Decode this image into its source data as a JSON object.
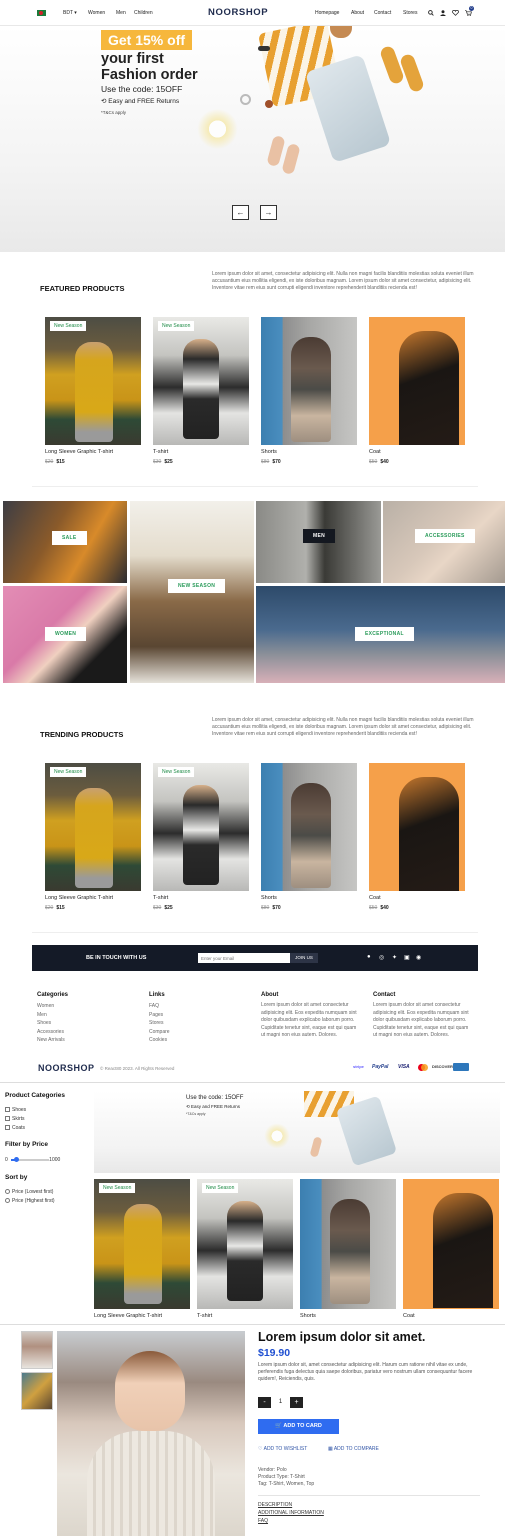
{
  "header": {
    "currency": "BDT",
    "nav_left": [
      "Women",
      "Men",
      "Children"
    ],
    "logo": "NOORSHOP",
    "nav_right": [
      "Homepage",
      "About",
      "Contact",
      "Stores"
    ],
    "cart_count": "0"
  },
  "hero": {
    "badge": "Get 15% off",
    "headline": "your first Fashion order",
    "code_text": "Use the code: 15OFF",
    "returns": "Easy and FREE Returns",
    "terms": "*T&Cs apply",
    "prev": "←",
    "next": "→"
  },
  "featured": {
    "title": "FEATURED PRODUCTS",
    "lorem": "Lorem ipsum dolor sit amet, consectetur adipisicing elit. Nulla non magni facilis blanditiis molestias soluta eveniet illum accusantium eius mollitia eligendi, ex iste doloribus magnam. Lorem ipsum dolor sit amet consectetur, adipisicing elit. Inventore vitae rem eius sunt corrupti eligendi inventore reprehenderit blanditiis recienda est!"
  },
  "products": [
    {
      "name": "Long Sleeve Graphic T-shirt",
      "old": "$20",
      "new": "$15",
      "badge": "New Season"
    },
    {
      "name": "T-shirt",
      "old": "$30",
      "new": "$25",
      "badge": "New Season"
    },
    {
      "name": "Shorts",
      "old": "$80",
      "new": "$70",
      "badge": ""
    },
    {
      "name": "Coat",
      "old": "$50",
      "new": "$40",
      "badge": ""
    }
  ],
  "collage": {
    "sale": "SALE",
    "women": "WOMEN",
    "new_season": "NEW SEASON",
    "men": "MEN",
    "accessories": "ACCESSORIES",
    "exceptional": "EXCEPTIONAL"
  },
  "trending": {
    "title": "TRENDING PRODUCTS"
  },
  "subscribe": {
    "title": "BE IN TOUCH WITH US",
    "placeholder": "Enter your Email",
    "button": "JOIN US"
  },
  "footer": {
    "categories_title": "Categories",
    "categories": [
      "Women",
      "Men",
      "Shoes",
      "Accessories",
      "New Arrivals"
    ],
    "links_title": "Links",
    "links": [
      "FAQ",
      "Pages",
      "Stores",
      "Compare",
      "Cookies"
    ],
    "about_title": "About",
    "about_text": "Lorem ipsum dolor sit amet consectetur adipisicing elit. Eos expedita numquam sint dolor quibusdam explicabo laborum porro. Cupiditate tenetur sint, eaque est qui quam ut magni non eius autem. Dolores.",
    "contact_title": "Contact",
    "contact_text": "Lorem ipsum dolor sit amet consectetur adipisicing elit. Eos expedita numquam sint dolor quibusdam explicabo laborum porro. Cupiditate tenetur sint, eaque est qui quam ut magni non eius autem. Dolores.",
    "logo": "NOORSHOP",
    "copyright": "© React80 2023. All Rights Reserved",
    "payments": [
      "stripe",
      "PayPal",
      "VISA",
      "DISCOVER"
    ]
  },
  "filters": {
    "categories_title": "Product Categories",
    "categories": [
      "Shoes",
      "Skirts",
      "Coats"
    ],
    "price_title": "Filter by Price",
    "price_min": "0",
    "price_max": "1000",
    "sort_title": "Sort by",
    "sort_options": [
      "Price (Lowest first)",
      "Price (Highest first)"
    ],
    "banner_code": "Use the code: 15OFF",
    "banner_returns": "Easy and FREE Returns",
    "banner_terms": "*T&Cs apply"
  },
  "list_products": [
    {
      "name": "Long Sleeve Graphic T-shirt",
      "badge": "New Season"
    },
    {
      "name": "T-shirt",
      "badge": "New Season"
    },
    {
      "name": "Shorts",
      "badge": ""
    },
    {
      "name": "Coat",
      "badge": ""
    }
  ],
  "product_detail": {
    "title": "Lorem ipsum dolor sit amet.",
    "price": "$19.90",
    "description": "Lorem ipsum dolor sit, amet consectetur adipisicing elit. Harum cum ratione nihil vitae ex unde, perferendis fuga delectus quia saepe doloribus, pariatur vero nostrum ullam consequuntur facere quidem!, Reiciendis, quis.",
    "qty_minus": "-",
    "qty": "1",
    "qty_plus": "+",
    "add_to_cart": "ADD TO CARD",
    "wishlist": "ADD TO WISHLIST",
    "compare": "ADD TO COMPARE",
    "vendor": "Vendor: Polo",
    "type": "Product Type: T-Shirt",
    "tags": "Tag: T-Shirt, Women, Top",
    "tabs": [
      "DESCRIPTION",
      "ADDITIONAL INFORMATION",
      "FAQ"
    ]
  }
}
